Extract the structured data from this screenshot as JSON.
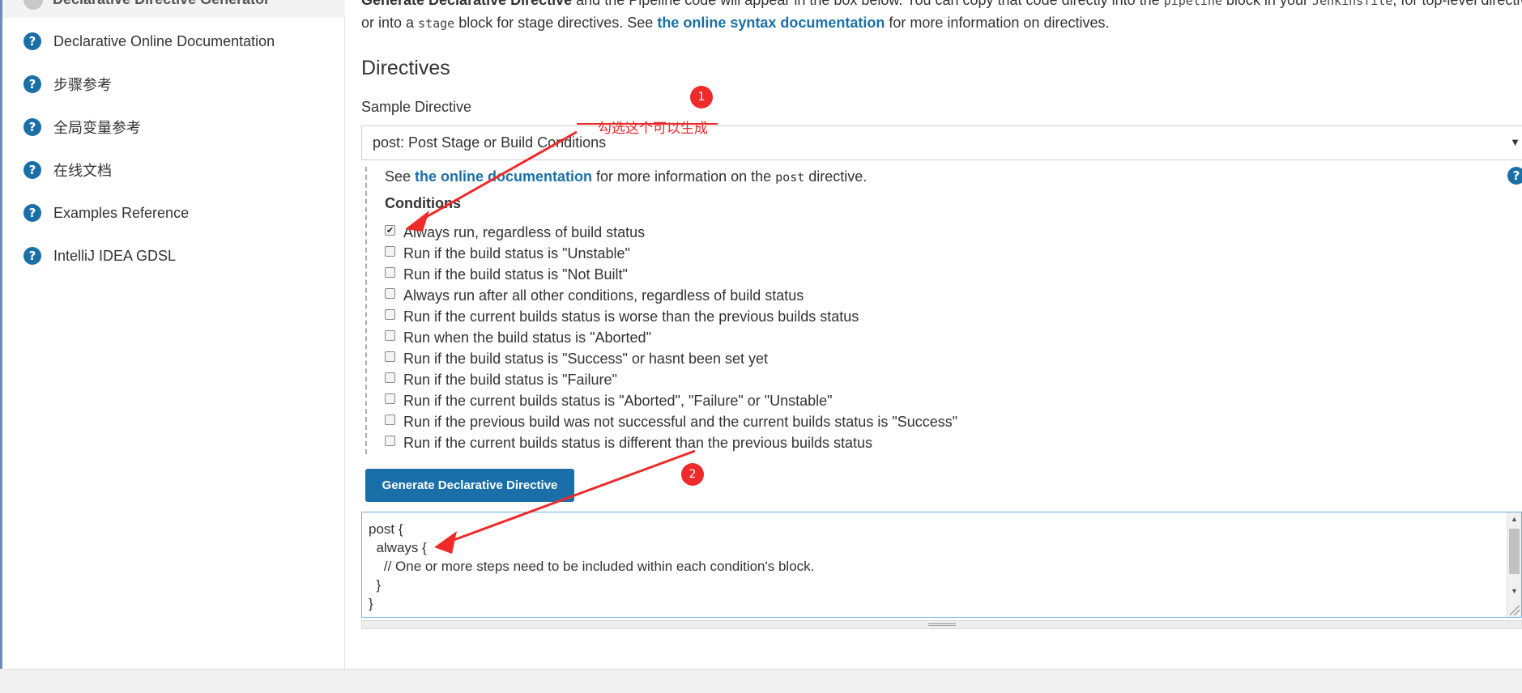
{
  "sidebar": {
    "cut_item_label": "Declarative Directive Generator",
    "items": [
      {
        "label": "Declarative Online Documentation",
        "icon": "help-icon"
      },
      {
        "label": "步骤参考",
        "icon": "help-icon"
      },
      {
        "label": "全局变量参考",
        "icon": "help-icon"
      },
      {
        "label": "在线文档",
        "icon": "help-icon"
      },
      {
        "label": "Examples Reference",
        "icon": "help-icon"
      },
      {
        "label": "IntelliJ IDEA GDSL",
        "icon": "help-icon"
      }
    ]
  },
  "intro": {
    "line1_bold": "Generate Declarative Directive",
    "line1_rest_a": " and the Pipeline code will appear in the box below. You can copy that code directly into the ",
    "line1_code_a": "pipeline",
    "line1_rest_b": " block in your ",
    "line1_code_b": "Jenkinsfile",
    "line1_rest_c": ", for top-level directives,",
    "line2_a": "or into a ",
    "line2_code": "stage",
    "line2_b": " block for stage directives. See ",
    "line2_link": "the online syntax documentation",
    "line2_c": " for more information on directives."
  },
  "directives": {
    "heading": "Directives",
    "sample_label": "Sample Directive",
    "selected": "post: Post Stage or Build Conditions",
    "see_prefix": "See ",
    "see_link": "the online documentation",
    "see_mid": " for more information on the ",
    "see_code": "post",
    "see_suffix": " directive.",
    "conditions_title": "Conditions",
    "conditions": [
      {
        "label": "Always run, regardless of build status",
        "checked": true
      },
      {
        "label": "Run if the build status is \"Unstable\"",
        "checked": false
      },
      {
        "label": "Run if the build status is \"Not Built\"",
        "checked": false
      },
      {
        "label": "Always run after all other conditions, regardless of build status",
        "checked": false
      },
      {
        "label": "Run if the current builds status is worse than the previous builds status",
        "checked": false
      },
      {
        "label": "Run when the build status is \"Aborted\"",
        "checked": false
      },
      {
        "label": "Run if the build status is \"Success\" or hasnt been set yet",
        "checked": false
      },
      {
        "label": "Run if the build status is \"Failure\"",
        "checked": false
      },
      {
        "label": "Run if the current builds status is \"Aborted\", \"Failure\" or \"Unstable\"",
        "checked": false
      },
      {
        "label": "Run if the previous build was not successful and the current builds status is \"Success\"",
        "checked": false
      },
      {
        "label": "Run if the current builds status is different than the previous builds status",
        "checked": false
      }
    ],
    "generate_button": "Generate Declarative Directive",
    "code_output": "post {\n  always {\n    // One or more steps need to be included within each condition's block.\n  }\n}"
  },
  "annotations": {
    "badge1": "1",
    "badge2": "2",
    "note1": "勾选这个可以生成",
    "color": "#ee2a2a"
  },
  "colors": {
    "accent": "#1b6fa8",
    "annotation": "#ee2a2a"
  }
}
